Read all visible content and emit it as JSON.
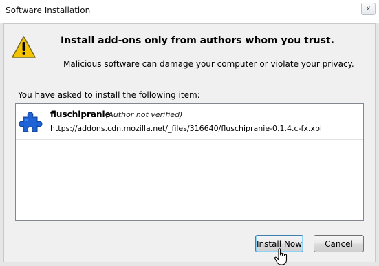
{
  "window": {
    "title": "Software Installation",
    "close_glyph": "x"
  },
  "dialog": {
    "heading": "Install add-ons only from authors whom you trust.",
    "subtext": "Malicious software can damage your computer or violate your privacy.",
    "list_label": "You have asked to install the following item:",
    "warning_icon": "warning-triangle-icon",
    "items": [
      {
        "name": "fluschipranie",
        "verification": "(Author not verified)",
        "url": "https://addons.cdn.mozilla.net/_files/316640/fluschipranie-0.1.4.c-fx.xpi",
        "icon": "puzzle-piece-icon"
      }
    ]
  },
  "buttons": {
    "install_label": "Install Now",
    "cancel_label": "Cancel"
  },
  "colors": {
    "client_background": "#f0f0f0",
    "warning_yellow": "#f5c400",
    "puzzle_blue": "#1f63d6",
    "default_button_border": "#3c7fb1"
  }
}
